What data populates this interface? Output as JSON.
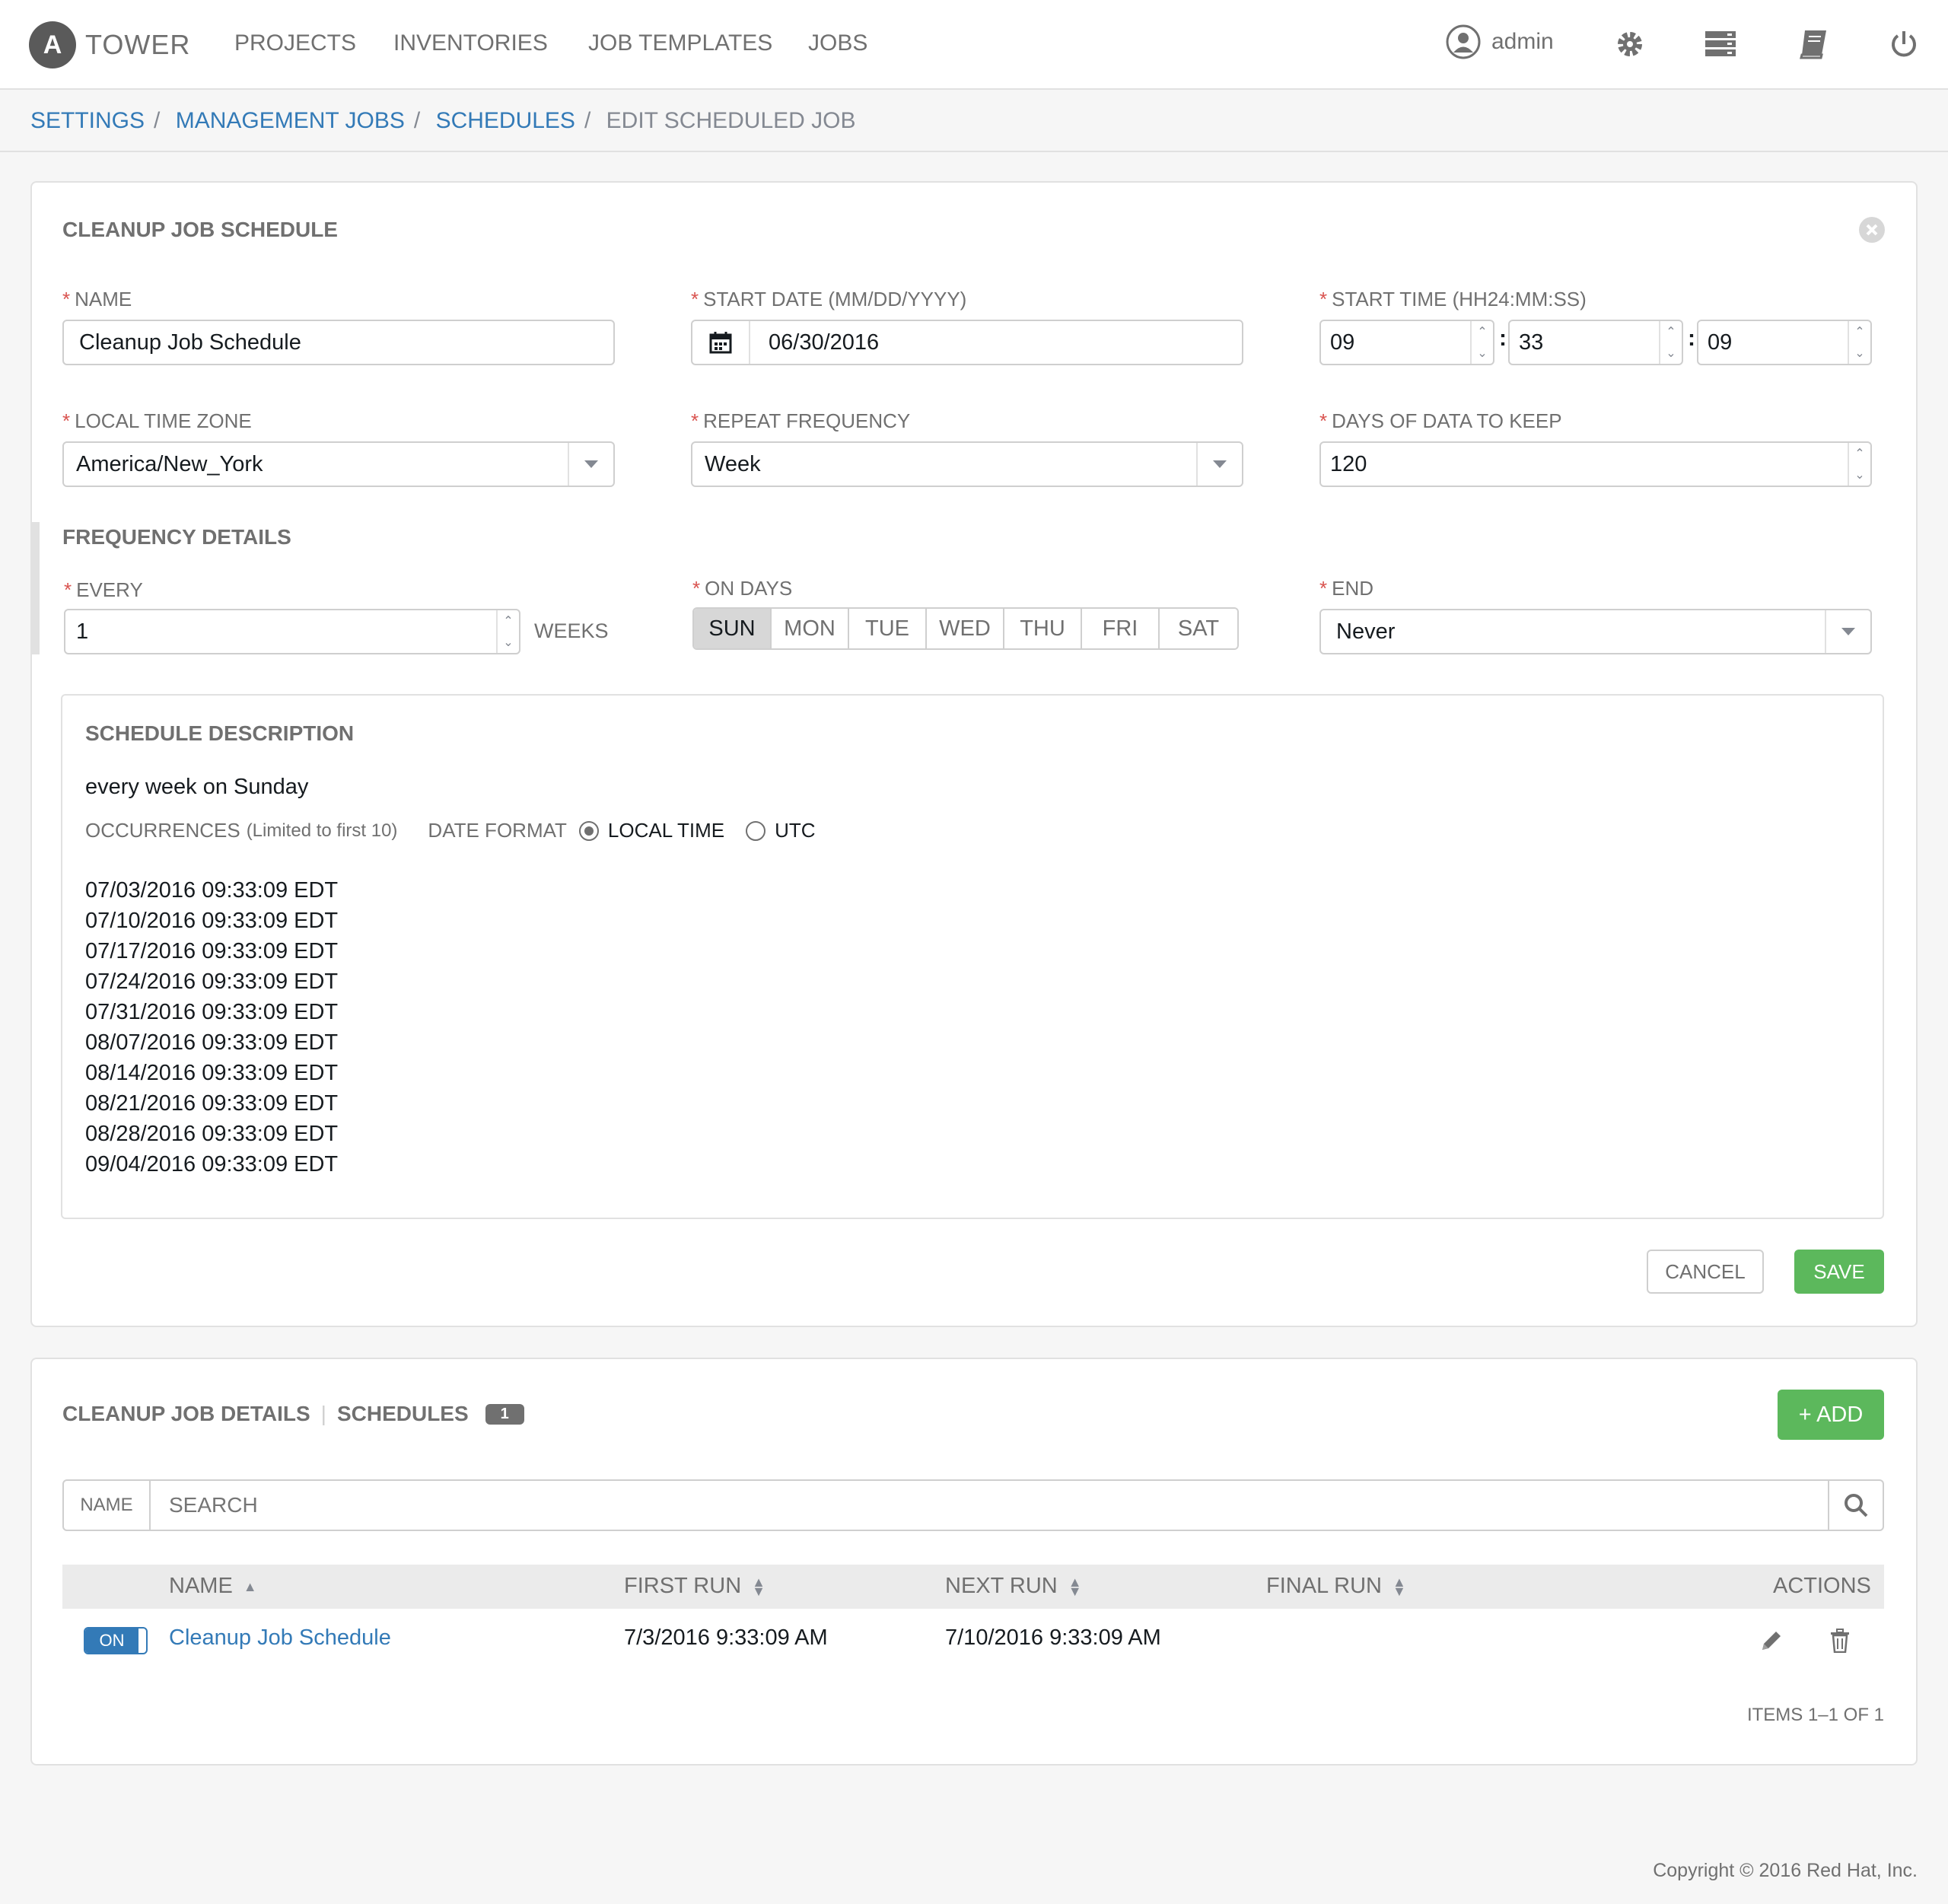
{
  "header": {
    "logo_letter": "A",
    "app_name": "TOWER",
    "nav": [
      "PROJECTS",
      "INVENTORIES",
      "JOB TEMPLATES",
      "JOBS"
    ],
    "user": "admin"
  },
  "breadcrumb": {
    "items": [
      "SETTINGS",
      "MANAGEMENT JOBS",
      "SCHEDULES"
    ],
    "current": "EDIT SCHEDULED JOB"
  },
  "form": {
    "title": "CLEANUP JOB SCHEDULE",
    "name_label": "NAME",
    "name_value": "Cleanup Job Schedule",
    "start_date_label": "START DATE (MM/DD/YYYY)",
    "start_date_value": "06/30/2016",
    "start_time_label": "START TIME (HH24:MM:SS)",
    "start_hour": "09",
    "start_minute": "33",
    "start_second": "09",
    "time_sep": ":",
    "timezone_label": "LOCAL TIME ZONE",
    "timezone_value": "America/New_York",
    "repeat_label": "REPEAT FREQUENCY",
    "repeat_value": "Week",
    "days_keep_label": "DAYS OF DATA TO KEEP",
    "days_keep_value": "120",
    "frequency_title": "FREQUENCY DETAILS",
    "every_label": "EVERY",
    "every_value": "1",
    "every_unit": "WEEKS",
    "on_days_label": "ON DAYS",
    "days": [
      "SUN",
      "MON",
      "TUE",
      "WED",
      "THU",
      "FRI",
      "SAT"
    ],
    "end_label": "END",
    "end_value": "Never",
    "required_mark": "*"
  },
  "description": {
    "title": "SCHEDULE DESCRIPTION",
    "text": "every week on Sunday",
    "occurrences_label": "OCCURRENCES",
    "occurrences_note": "(Limited to first 10)",
    "date_format_label": "DATE FORMAT",
    "local_time_label": "LOCAL TIME",
    "utc_label": "UTC",
    "occurrences": [
      "07/03/2016 09:33:09 EDT",
      "07/10/2016 09:33:09 EDT",
      "07/17/2016 09:33:09 EDT",
      "07/24/2016 09:33:09 EDT",
      "07/31/2016 09:33:09 EDT",
      "08/07/2016 09:33:09 EDT",
      "08/14/2016 09:33:09 EDT",
      "08/21/2016 09:33:09 EDT",
      "08/28/2016 09:33:09 EDT",
      "09/04/2016 09:33:09 EDT"
    ]
  },
  "actions": {
    "cancel": "CANCEL",
    "save": "SAVE"
  },
  "list": {
    "tab_details": "CLEANUP JOB DETAILS",
    "tab_sep": "|",
    "tab_schedules": "SCHEDULES",
    "count": "1",
    "add_label": "+ ADD",
    "search_field": "NAME",
    "search_placeholder": "SEARCH",
    "columns": {
      "name": "NAME",
      "first_run": "FIRST RUN",
      "next_run": "NEXT RUN",
      "final_run": "FINAL RUN",
      "actions": "ACTIONS"
    },
    "rows": [
      {
        "toggle": "ON",
        "name": "Cleanup Job Schedule",
        "first_run": "7/3/2016 9:33:09 AM",
        "next_run": "7/10/2016 9:33:09 AM",
        "final_run": ""
      }
    ],
    "pagination": "ITEMS 1–1 OF 1"
  },
  "footer": {
    "copyright": "Copyright © 2016 Red Hat, Inc."
  },
  "colors": {
    "link": "#337ab7",
    "success": "#5cb85c",
    "required": "#d9534f",
    "muted": "#707070"
  }
}
